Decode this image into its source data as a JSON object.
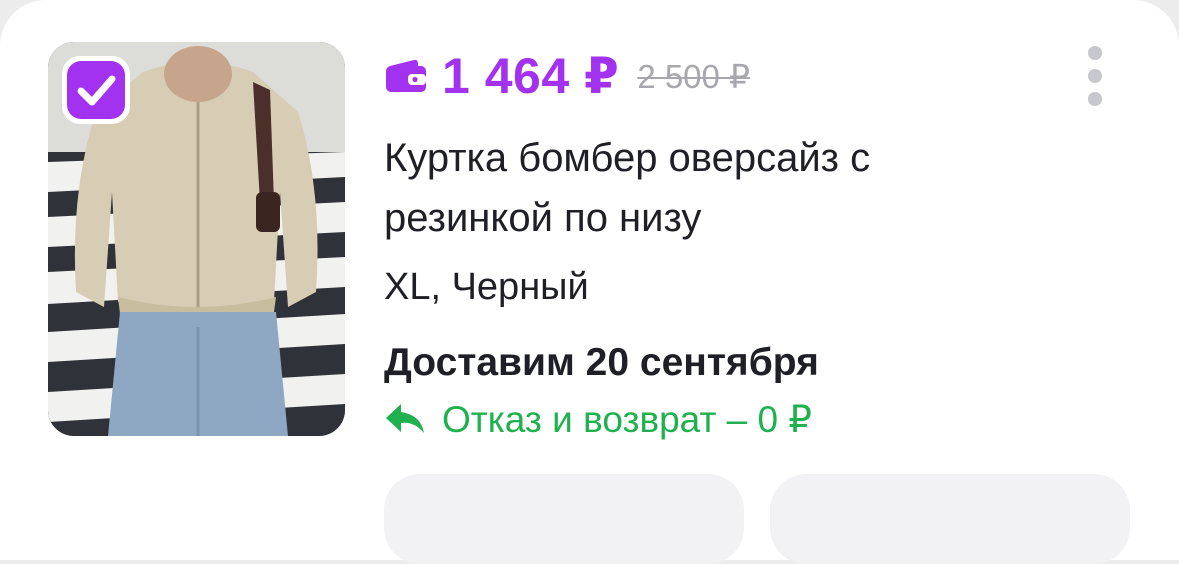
{
  "product": {
    "price": "1 464 ₽",
    "old_price": "2 500 ₽",
    "title": "Куртка бомбер оверсайз с резинкой по низу",
    "variant": "XL, Черный",
    "delivery": "Доставим 20 сентября",
    "returns": "Отказ и возврат – 0 ₽",
    "selected": true
  },
  "icons": {
    "price": "wallet-icon",
    "returns": "return-arrow-icon",
    "menu": "more-vertical-icon",
    "checkbox": "checkmark-icon"
  },
  "colors": {
    "accent": "#a331f0",
    "success": "#1eb14e",
    "muted": "#a7a7ad",
    "text": "#1f1f26"
  }
}
